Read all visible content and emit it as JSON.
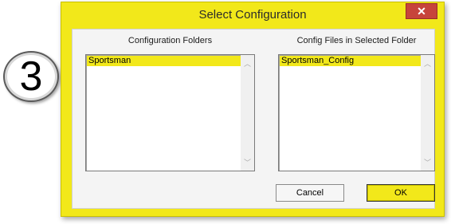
{
  "step_badge": {
    "number": "3"
  },
  "window": {
    "title": "Select Configuration",
    "close_glyph": "✕",
    "accent_color": "#f2e81a"
  },
  "folders": {
    "label": "Configuration Folders",
    "items": [
      "Sportsman"
    ],
    "selected": "Sportsman"
  },
  "files": {
    "label": "Config Files in Selected Folder",
    "items": [
      "Sportsman_Config"
    ],
    "selected": "Sportsman_Config"
  },
  "buttons": {
    "cancel_label": "Cancel",
    "ok_label": "OK"
  },
  "icons": {
    "scroll_up": "chevron-up-icon",
    "scroll_down": "chevron-down-icon",
    "close": "close-icon"
  }
}
